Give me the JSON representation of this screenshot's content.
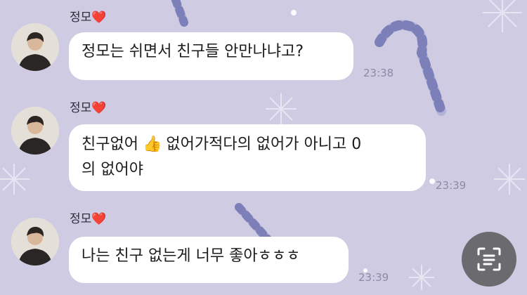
{
  "messages": [
    {
      "sender": "정모",
      "heart": "❤️",
      "text": "정모는 쉬면서 친구들 안만나냐고?",
      "time": "23:38"
    },
    {
      "sender": "정모",
      "heart": "❤️",
      "text_part1": "친구없어",
      "emoji": "👍",
      "text_part2": "없어가적다의 없어가 아니고 0",
      "text_line2": "의 없어야",
      "time": "23:39"
    },
    {
      "sender": "정모",
      "heart": "❤️",
      "text": "나는 친구 없는게 너무 좋아ㅎㅎㅎ",
      "time": "23:39"
    }
  ],
  "icons": {
    "avatar": "profile-photo-icon",
    "emoji": "thumbs-up-icon",
    "ocr": "text-scan-icon"
  },
  "colors": {
    "background": "#cfcbe3",
    "bubble": "#ffffff",
    "time": "#8e8aa3",
    "heart": "#e3202e"
  }
}
